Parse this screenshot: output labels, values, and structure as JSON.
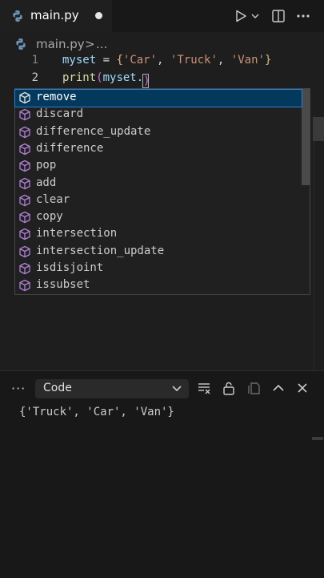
{
  "tab": {
    "title": "main.py",
    "dirty": true
  },
  "toolbar": {
    "run_icon": "run-python-icon",
    "run_dropdown_icon": "chevron-down-icon",
    "split_icon": "split-editor-icon",
    "more_icon": "more-actions-icon"
  },
  "breadcrumb": {
    "file": "main.py",
    "separator": ">",
    "more": "..."
  },
  "editor": {
    "lines": [
      {
        "number": "1"
      },
      {
        "number": "2"
      }
    ],
    "line1": {
      "var": "myset",
      "eq": " = ",
      "open": "{",
      "s1": "'Car'",
      "c1": ", ",
      "s2": "'Truck'",
      "c2": ", ",
      "s3": "'Van'",
      "close": "}"
    },
    "line2": {
      "fn": "print",
      "open": "(",
      "arg": "myset.",
      "close": ")"
    }
  },
  "suggestions": {
    "icon": "method-cube-icon",
    "items": [
      "remove",
      "discard",
      "difference_update",
      "difference",
      "pop",
      "add",
      "clear",
      "copy",
      "intersection",
      "intersection_update",
      "isdisjoint",
      "issubset"
    ],
    "selected_index": 0
  },
  "panel": {
    "more_label": "···",
    "select_value": "Code",
    "tools": [
      "clear-output-icon",
      "lock-icon",
      "copy-icon",
      "chevron-up-icon",
      "close-icon"
    ],
    "output": "{'Truck', 'Car', 'Van'}"
  },
  "colors": {
    "background": "#1e1e1e",
    "selection": "#04395e",
    "method_icon": "#b180d7",
    "string": "#ce9178",
    "variable": "#9cdcfe"
  }
}
